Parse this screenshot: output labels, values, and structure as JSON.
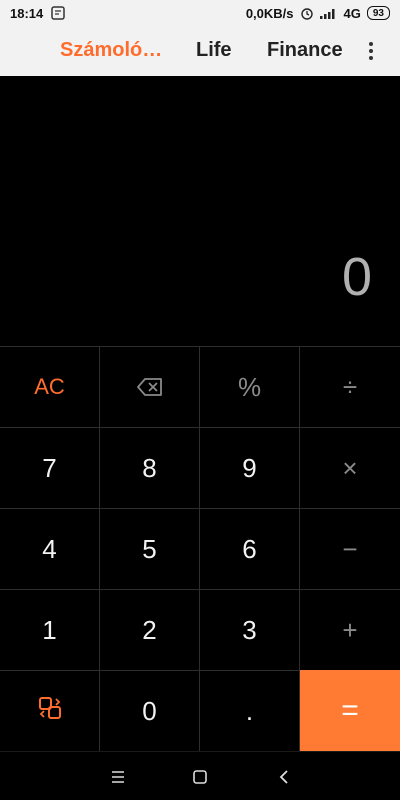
{
  "status_bar": {
    "time": "18:14",
    "network_speed": "0,0KB/s",
    "network_type": "4G",
    "battery_level": "93",
    "icons": [
      "notification-icon",
      "alarm-icon",
      "signal-icon",
      "battery-icon"
    ]
  },
  "tabs": {
    "calculator": "Számoló…",
    "life": "Life",
    "finance": "Finance",
    "active": "calculator"
  },
  "display": {
    "value": "0"
  },
  "keypad": {
    "rows": [
      [
        "AC",
        "backspace-icon",
        "%",
        "÷"
      ],
      [
        "7",
        "8",
        "9",
        "×"
      ],
      [
        "4",
        "5",
        "6",
        "−"
      ],
      [
        "1",
        "2",
        "3",
        "+"
      ],
      [
        "convert-icon",
        "0",
        ".",
        "="
      ]
    ],
    "ac": "AC",
    "percent": "%",
    "divide": "÷",
    "multiply": "×",
    "minus": "−",
    "plus": "+",
    "seven": "7",
    "eight": "8",
    "nine": "9",
    "four": "4",
    "five": "5",
    "six": "6",
    "one": "1",
    "two": "2",
    "three": "3",
    "zero": "0",
    "dot": ".",
    "equals": "="
  },
  "colors": {
    "accent": "#ff6d2e",
    "equals_bg": "#ff7a33",
    "background": "#000000",
    "display_text": "#b0b0b0"
  },
  "nav_bar": {
    "icons": [
      "menu-icon",
      "home-icon",
      "back-icon"
    ]
  }
}
